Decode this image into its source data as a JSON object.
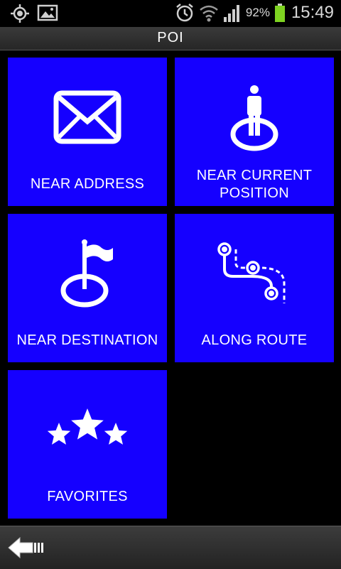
{
  "status_bar": {
    "icons_left": [
      "gps-icon",
      "image-icon"
    ],
    "icons_right": [
      "alarm-icon",
      "wifi-icon",
      "signal-icon",
      "battery-icon"
    ],
    "battery_percent": "92%",
    "time": "15:49"
  },
  "header": {
    "title": "POI"
  },
  "tiles": [
    {
      "label": "NEAR ADDRESS",
      "icon": "envelope-icon"
    },
    {
      "label_line1": "NEAR CURRENT",
      "label_line2": "POSITION",
      "icon": "person-position-icon"
    },
    {
      "label": "NEAR DESTINATION",
      "icon": "flag-destination-icon"
    },
    {
      "label": "ALONG ROUTE",
      "icon": "route-icon"
    },
    {
      "label": "FAVORITES",
      "icon": "stars-icon"
    }
  ],
  "footer": {
    "back_icon": "back-arrow-icon"
  },
  "colors": {
    "tile": "#1500ff",
    "background": "#000000",
    "text": "#ffffff",
    "battery": "#7ed321"
  }
}
